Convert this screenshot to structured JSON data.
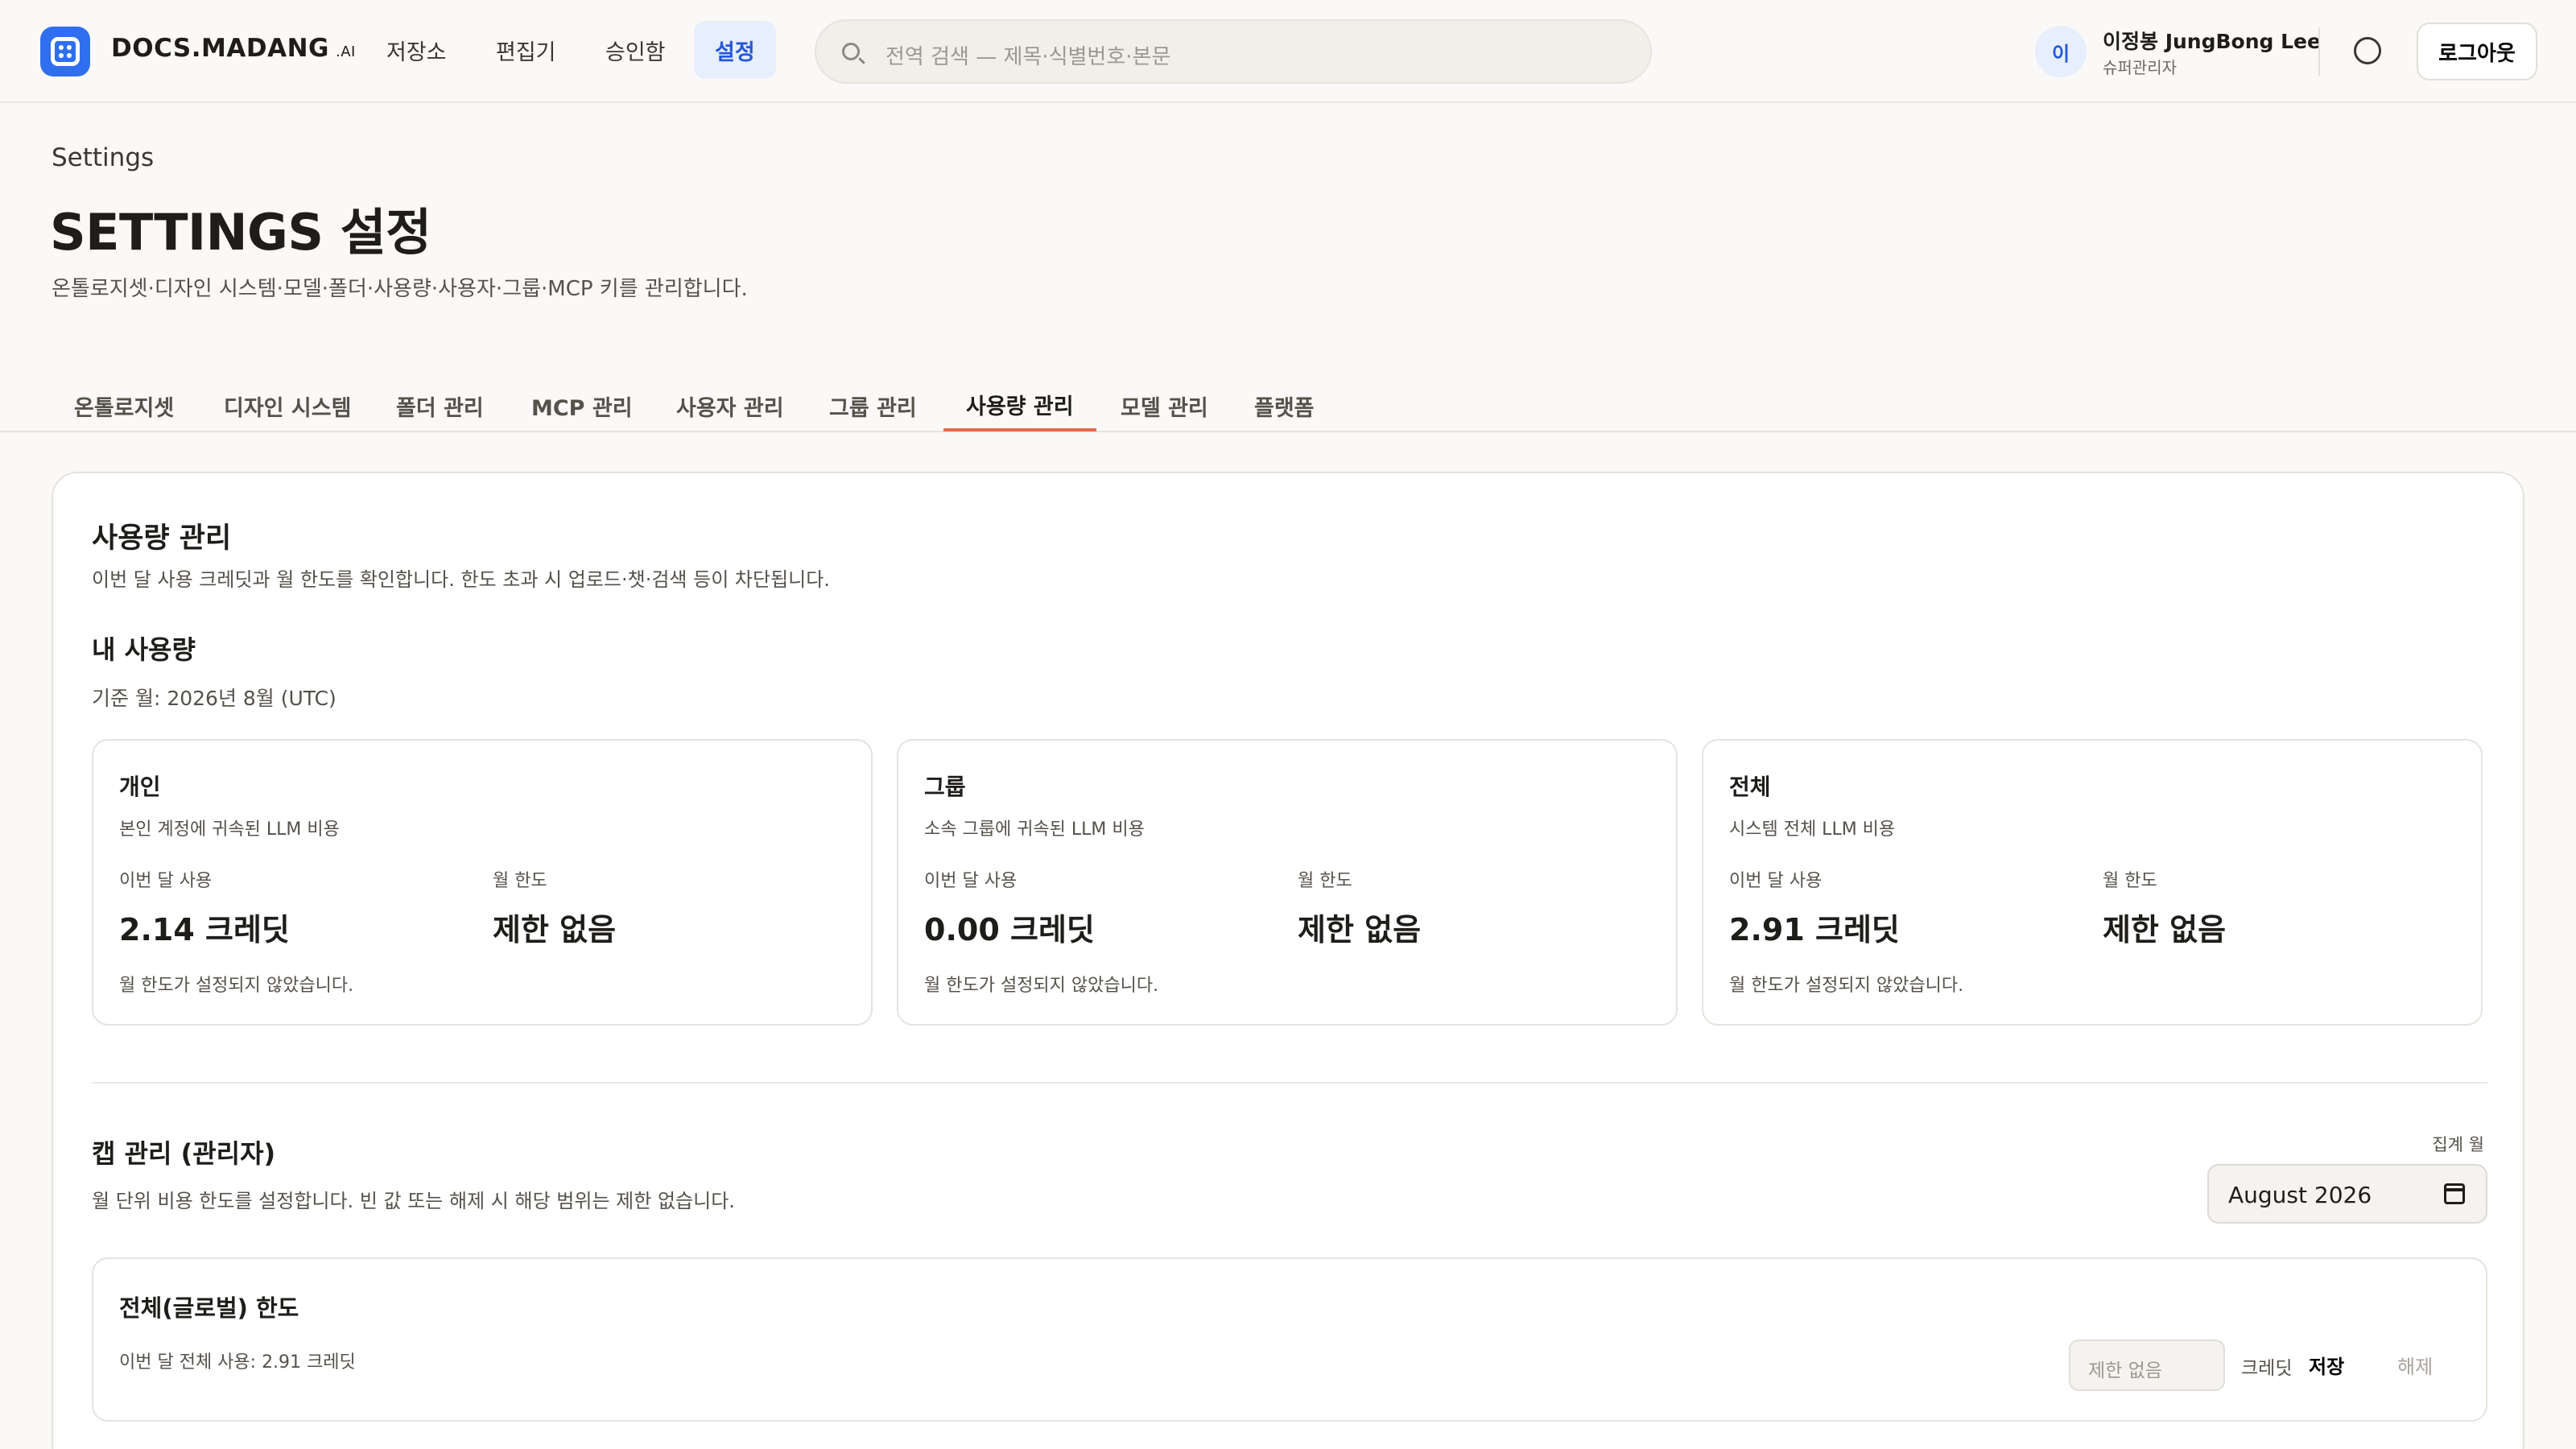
{
  "brand": {
    "name": "DOCS.MADANG",
    "suffix": ".AI"
  },
  "nav": [
    {
      "label": "저장소"
    },
    {
      "label": "편집기"
    },
    {
      "label": "승인함"
    },
    {
      "label": "설정",
      "active": true
    }
  ],
  "search": {
    "placeholder": "전역 검색 — 제목·식별번호·본문"
  },
  "user": {
    "initial": "이",
    "name": "이정봉 JungBong Lee",
    "role": "슈퍼관리자"
  },
  "header": {
    "logout_label": "로그아웃"
  },
  "page": {
    "crumb": "Settings",
    "title": "SETTINGS 설정",
    "description": "온톨로지셋·디자인 시스템·모델·폴더·사용량·사용자·그룹·MCP 키를 관리합니다."
  },
  "tabs": [
    {
      "label": "온톨로지셋"
    },
    {
      "label": "디자인 시스템"
    },
    {
      "label": "폴더 관리"
    },
    {
      "label": "MCP 관리"
    },
    {
      "label": "사용자 관리"
    },
    {
      "label": "그룹 관리"
    },
    {
      "label": "사용량 관리",
      "active": true
    },
    {
      "label": "모델 관리"
    },
    {
      "label": "플랫폼"
    }
  ],
  "usage": {
    "title": "사용량 관리",
    "description": "이번 달 사용 크레딧과 월 한도를 확인합니다. 한도 초과 시 업로드·챗·검색 등이 차단됩니다.",
    "mine_title": "내 사용량",
    "period": "기준 월: 2026년 8월 (UTC)",
    "cards": [
      {
        "title": "개인",
        "desc": "본인 계정에 귀속된 LLM 비용",
        "used_label": "이번 달 사용",
        "used": "2.14 크레딧",
        "limit_label": "월 한도",
        "limit": "제한 없음",
        "note": "월 한도가 설정되지 않았습니다."
      },
      {
        "title": "그룹",
        "desc": "소속 그룹에 귀속된 LLM 비용",
        "used_label": "이번 달 사용",
        "used": "0.00 크레딧",
        "limit_label": "월 한도",
        "limit": "제한 없음",
        "note": "월 한도가 설정되지 않았습니다."
      },
      {
        "title": "전체",
        "desc": "시스템 전체 LLM 비용",
        "used_label": "이번 달 사용",
        "used": "2.91 크레딧",
        "limit_label": "월 한도",
        "limit": "제한 없음",
        "note": "월 한도가 설정되지 않았습니다."
      }
    ]
  },
  "caps": {
    "title": "캡 관리 (관리자)",
    "description": "월 단위 비용 한도를 설정합니다. 빈 값 또는 해제 시 해당 범위는 제한 없습니다.",
    "month_label": "집계 월",
    "month_value": "August  2026",
    "global": {
      "title": "전체(글로벌) 한도",
      "usage": "이번 달 전체 사용: 2.91 크레딧",
      "input_placeholder": "제한  없음",
      "unit": "크레딧",
      "save_label": "저장",
      "clear_label": "해제"
    }
  },
  "colors": {
    "accent": "#2f6fef",
    "tab_underline": "#e8684a"
  }
}
